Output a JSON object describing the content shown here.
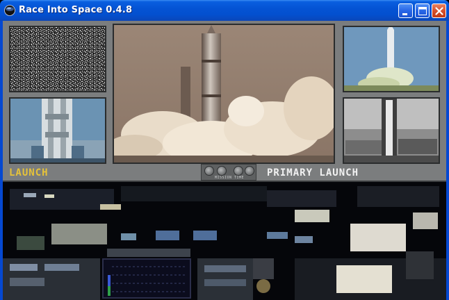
{
  "window": {
    "title": "Race Into Space 0.4.8",
    "icon": "app-globe-icon",
    "controls": [
      "minimize-icon",
      "maximize-icon",
      "close-icon"
    ]
  },
  "game": {
    "status_left": "LAUNCH",
    "status_right": "PRIMARY LAUNCH",
    "mission_time_label": "MISSION TIME"
  },
  "colors": {
    "title_bar": "#0453d4",
    "panel_gray": "#7b7d7e",
    "launch_label": "#e5c23a",
    "primary_label": "#f1f1f1"
  }
}
